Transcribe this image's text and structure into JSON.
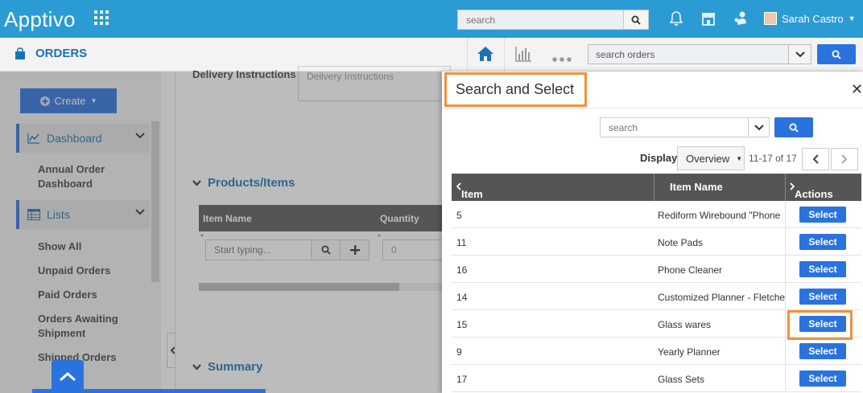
{
  "topbar": {
    "logo": "Apptivo",
    "search_placeholder": "search",
    "user_name": "Sarah Castro"
  },
  "subbar": {
    "app_title": "ORDERS",
    "search_value": "search orders"
  },
  "sidebar": {
    "create_label": "Create",
    "dashboard_label": "Dashboard",
    "annual_dashboard": "Annual Order Dashboard",
    "lists_label": "Lists",
    "items": [
      "Show All",
      "Unpaid Orders",
      "Paid Orders",
      "Orders Awaiting Shipment",
      "Shipped Orders"
    ]
  },
  "main": {
    "delivery_label": "Delivery Instructions",
    "delivery_placeholder": "Delivery Instructions",
    "products_section": "Products/Items",
    "col_item_name": "Item Name",
    "col_quantity": "Quantity",
    "typing_placeholder": "Start typing...",
    "qty_placeholder": "0",
    "summary_section": "Summary"
  },
  "modal": {
    "title": "Search and Select",
    "search_placeholder": "search",
    "display_label": "Display",
    "display_value": "Overview",
    "page_info": "11-17 of 17",
    "columns": {
      "item_no": "Item #",
      "item_name": "Item Name",
      "actions": "Actions"
    },
    "select_label": "Select",
    "rows": [
      {
        "num": "5",
        "name": "Rediform Wirebound \"Phone"
      },
      {
        "num": "11",
        "name": "Note Pads"
      },
      {
        "num": "16",
        "name": "Phone Cleaner"
      },
      {
        "num": "14",
        "name": "Customized Planner - Fletche"
      },
      {
        "num": "15",
        "name": "Glass wares"
      },
      {
        "num": "9",
        "name": "Yearly Planner"
      },
      {
        "num": "17",
        "name": "Glass Sets"
      }
    ]
  },
  "colors": {
    "brand_blue": "#2b9bd3",
    "button_blue": "#2a73de",
    "highlight_orange": "#f0923a"
  }
}
